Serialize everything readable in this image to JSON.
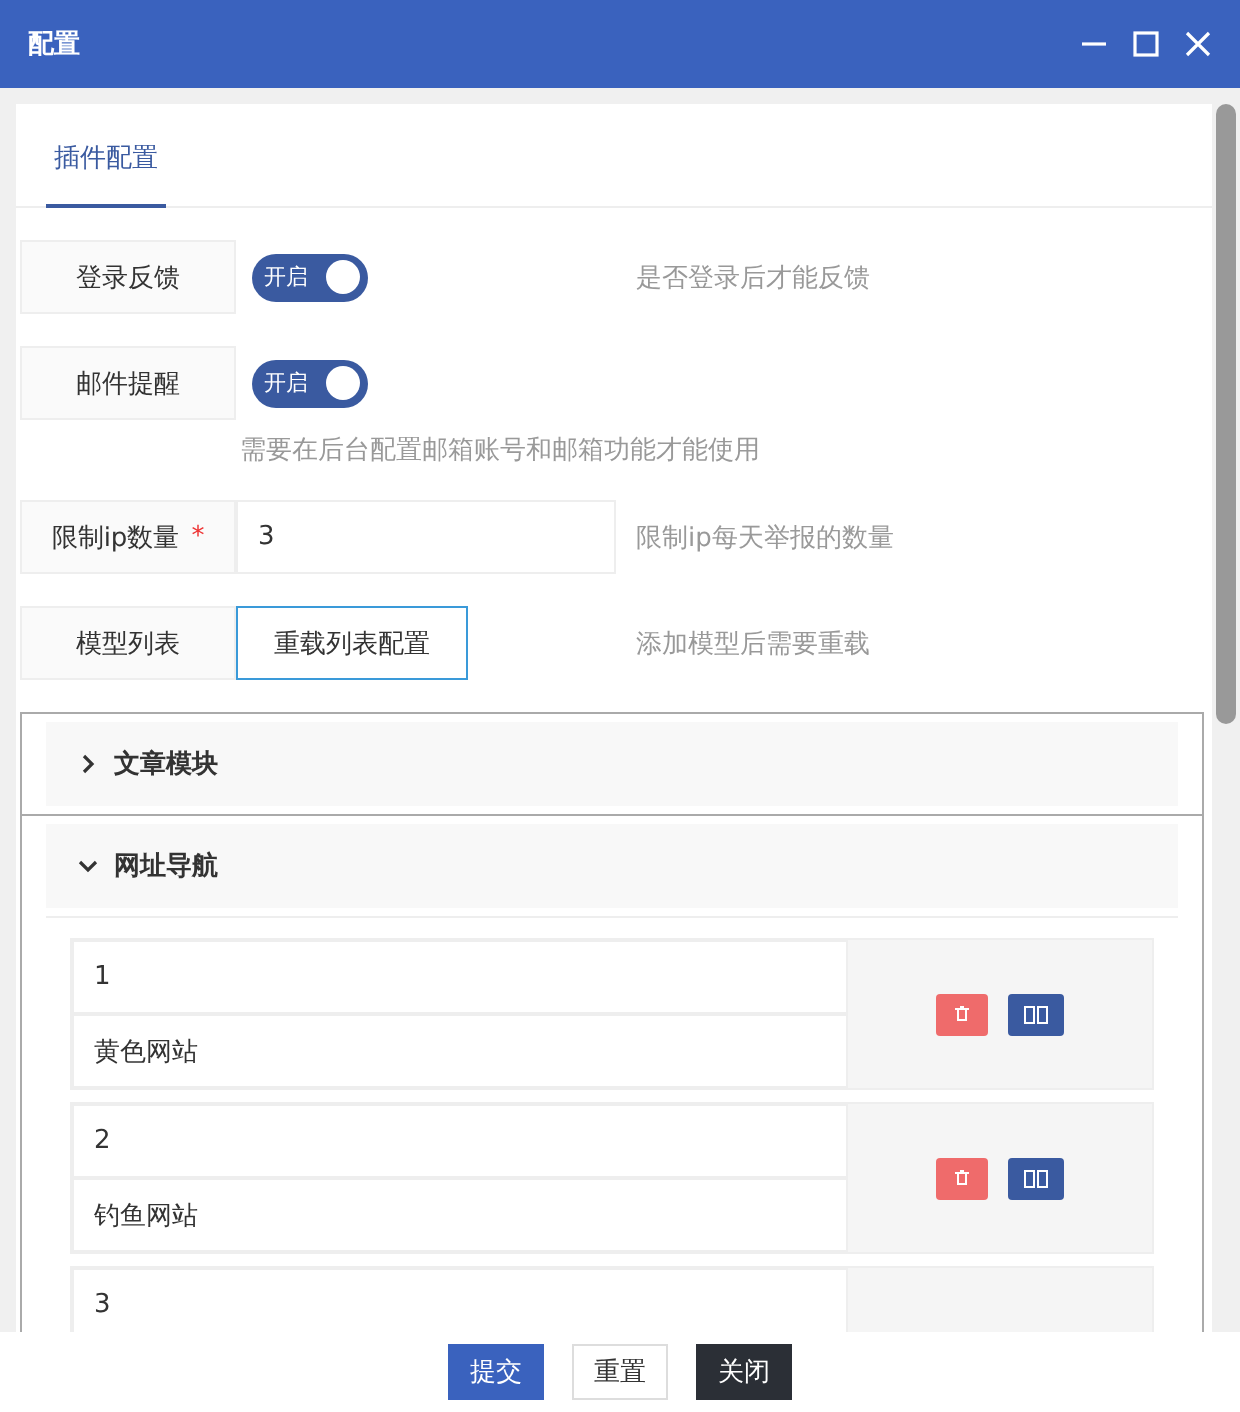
{
  "window": {
    "title": "配置"
  },
  "tabs": [
    {
      "label": "插件配置",
      "selected": true
    }
  ],
  "form": [
    {
      "kind": "switch",
      "label": "登录反馈",
      "on": true,
      "switch_text": "开启",
      "hint": "是否登录后才能反馈",
      "hint_below": false
    },
    {
      "kind": "switch",
      "label": "邮件提醒",
      "on": true,
      "switch_text": "开启",
      "hint": "需要在后台配置邮箱账号和邮箱功能才能使用",
      "hint_below": true
    },
    {
      "kind": "input",
      "label": "限制ip数量",
      "required_mark": "*",
      "value": "3",
      "hint": "限制ip每天举报的数量",
      "hint_below": false
    },
    {
      "kind": "button",
      "label": "模型列表",
      "button": "重载列表配置",
      "hint": "添加模型后需要重载",
      "hint_below": false
    }
  ],
  "panels": [
    {
      "title": "文章模块",
      "expanded": false
    },
    {
      "title": "网址导航",
      "expanded": true,
      "items": [
        {
          "index": "1",
          "name": "黄色网站"
        },
        {
          "index": "2",
          "name": "钓鱼网站"
        },
        {
          "index": "3"
        }
      ]
    }
  ],
  "buttons": [
    {
      "label": "提交",
      "kind": "primary"
    },
    {
      "label": "重置",
      "kind": "default"
    },
    {
      "label": "关闭",
      "kind": "dark"
    }
  ]
}
